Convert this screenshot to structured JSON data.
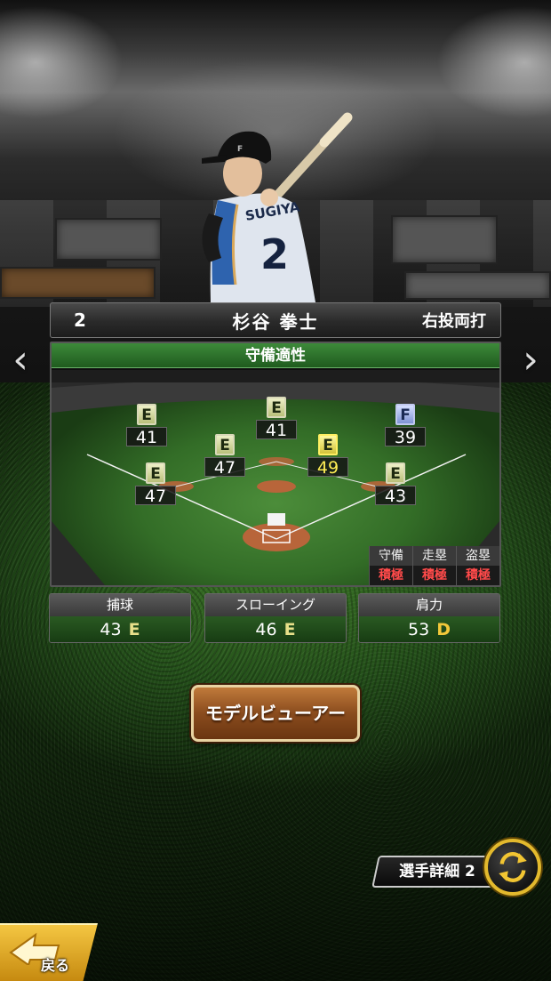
{
  "header": {
    "number": "2",
    "name": "杉谷 拳士",
    "handedness": "右投両打"
  },
  "defense": {
    "title": "守備適性",
    "positions": [
      {
        "id": "left-field",
        "grade": "E",
        "value": "41",
        "active": false
      },
      {
        "id": "center-field",
        "grade": "E",
        "value": "41",
        "active": false
      },
      {
        "id": "right-field",
        "grade": "F",
        "value": "39",
        "active": false
      },
      {
        "id": "shortstop",
        "grade": "E",
        "value": "47",
        "active": false
      },
      {
        "id": "second-base",
        "grade": "E",
        "value": "49",
        "active": true
      },
      {
        "id": "third-base",
        "grade": "E",
        "value": "47",
        "active": false
      },
      {
        "id": "first-base",
        "grade": "E",
        "value": "43",
        "active": false
      }
    ],
    "tendencies": [
      {
        "label": "守備",
        "value": "積極"
      },
      {
        "label": "走塁",
        "value": "積極"
      },
      {
        "label": "盗塁",
        "value": "積極"
      }
    ]
  },
  "stats": [
    {
      "label": "捕球",
      "value": "43",
      "grade": "E",
      "grade_color": "#e8e08a"
    },
    {
      "label": "スローイング",
      "value": "46",
      "grade": "E",
      "grade_color": "#e8e08a"
    },
    {
      "label": "肩力",
      "value": "53",
      "grade": "D",
      "grade_color": "#f2c83a"
    }
  ],
  "model_viewer_label": "モデルビューアー",
  "player_detail_label": "選手詳細 2",
  "back_label": "戻る",
  "nav": {
    "prev": "‹",
    "next": "›"
  },
  "jersey": {
    "name": "SUGIYA",
    "number": "2"
  }
}
